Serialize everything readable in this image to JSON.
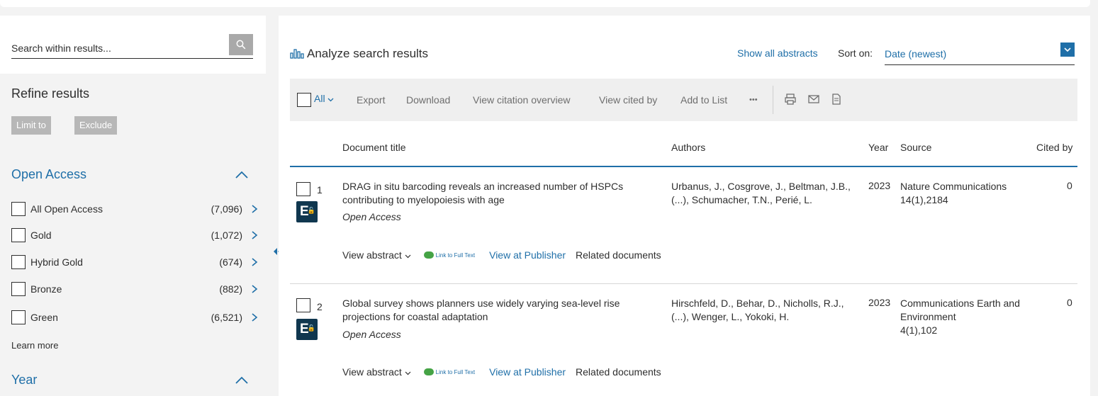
{
  "sidebar": {
    "search_placeholder": "Search within results...",
    "refine_title": "Refine results",
    "limit_label": "Limit to",
    "exclude_label": "Exclude",
    "open_access": {
      "title": "Open Access",
      "items": [
        {
          "label": "All Open Access",
          "count": "(7,096)"
        },
        {
          "label": "Gold",
          "count": "(1,072)"
        },
        {
          "label": "Hybrid Gold",
          "count": "(674)"
        },
        {
          "label": "Bronze",
          "count": "(882)"
        },
        {
          "label": "Green",
          "count": "(6,521)"
        }
      ],
      "learn_more": "Learn more"
    },
    "year_title": "Year"
  },
  "main": {
    "analyze_label": "Analyze search results",
    "show_abstracts": "Show all abstracts",
    "sort_label": "Sort on:",
    "sort_value": "Date (newest)",
    "toolbar": {
      "all_label": "All",
      "export": "Export",
      "download": "Download",
      "view_citation": "View citation overview",
      "view_cited_by": "View cited by",
      "add_to_list": "Add to List",
      "more": "•••"
    },
    "columns": {
      "title": "Document title",
      "authors": "Authors",
      "year": "Year",
      "source": "Source",
      "cited_by": "Cited by"
    },
    "results": [
      {
        "num": "1",
        "title": "DRAG in situ barcoding reveals an increased number of HSPCs contributing to myelopoiesis with age",
        "access": "Open Access",
        "authors": "Urbanus, J., Cosgrove, J., Beltman, J.B., (...), Schumacher, T.N., Perié, L.",
        "year": "2023",
        "source_name": "Nature Communications",
        "source_detail": "14(1),2184",
        "cited": "0"
      },
      {
        "num": "2",
        "title": "Global survey shows planners use widely varying sea-level rise projections for coastal adaptation",
        "access": "Open Access",
        "authors": "Hirschfeld, D., Behar, D., Nicholls, R.J., (...), Wenger, L., Yokoki, H.",
        "year": "2023",
        "source_name": "Communications Earth and Environment",
        "source_detail": "4(1),102",
        "cited": "0"
      }
    ],
    "actions": {
      "view_abstract": "View abstract",
      "link_full_text": "Link to Full Text",
      "view_publisher": "View at Publisher",
      "related": "Related documents"
    }
  },
  "colors": {
    "accent": "#1f6fa8",
    "badge": "#10374f",
    "link_full_text": "#45a345"
  }
}
